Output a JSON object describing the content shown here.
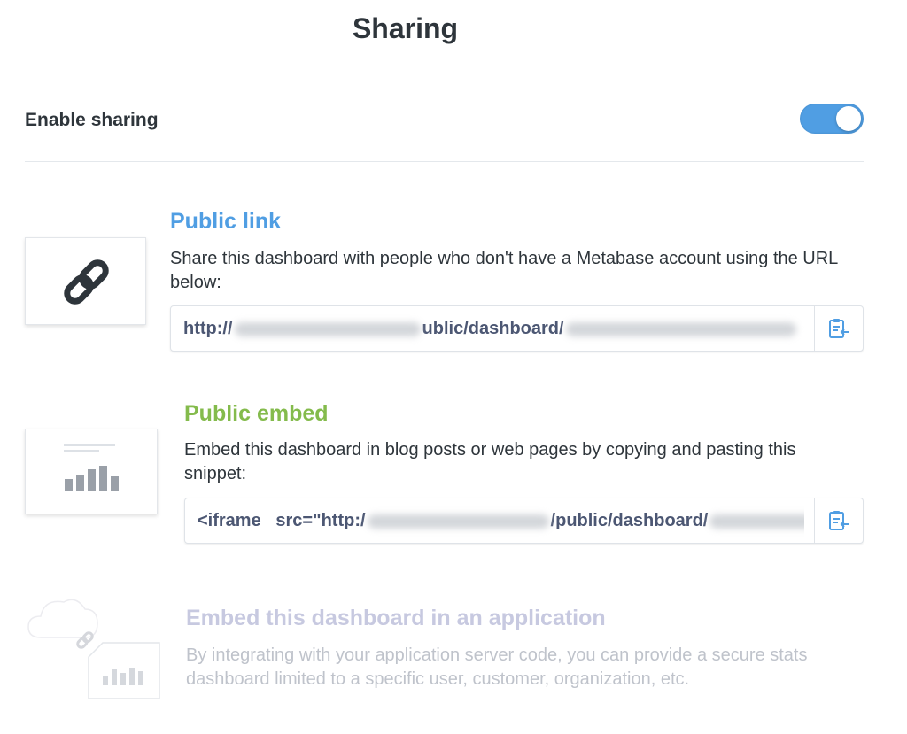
{
  "header": {
    "title": "Sharing"
  },
  "enable": {
    "label": "Enable sharing",
    "enabled": true
  },
  "public_link": {
    "title": "Public link",
    "description": "Share this dashboard with people who don't have a Metabase account using the URL below:",
    "url_prefix": "http://",
    "url_middle": "ublic/dashboard/",
    "icon": "link-icon",
    "copy_icon": "clipboard-icon"
  },
  "public_embed": {
    "title": "Public embed",
    "description": "Embed this dashboard in blog posts or web pages by copying and pasting this snippet:",
    "snippet_prefix": "<iframe   src=\"http:/",
    "snippet_middle": "/public/dashboard/",
    "icon": "embed-preview-icon",
    "copy_icon": "clipboard-icon"
  },
  "app_embed": {
    "title": "Embed this dashboard in an application",
    "description": "By integrating with your application server code, you can provide a secure stats dashboard limited to a specific user, customer, organization, etc.",
    "icon": "app-embed-icon"
  },
  "colors": {
    "accent_blue": "#509ee3",
    "accent_green": "#84bb4c",
    "muted_title": "#c7c9e0",
    "muted_text": "#bfc3cb"
  }
}
